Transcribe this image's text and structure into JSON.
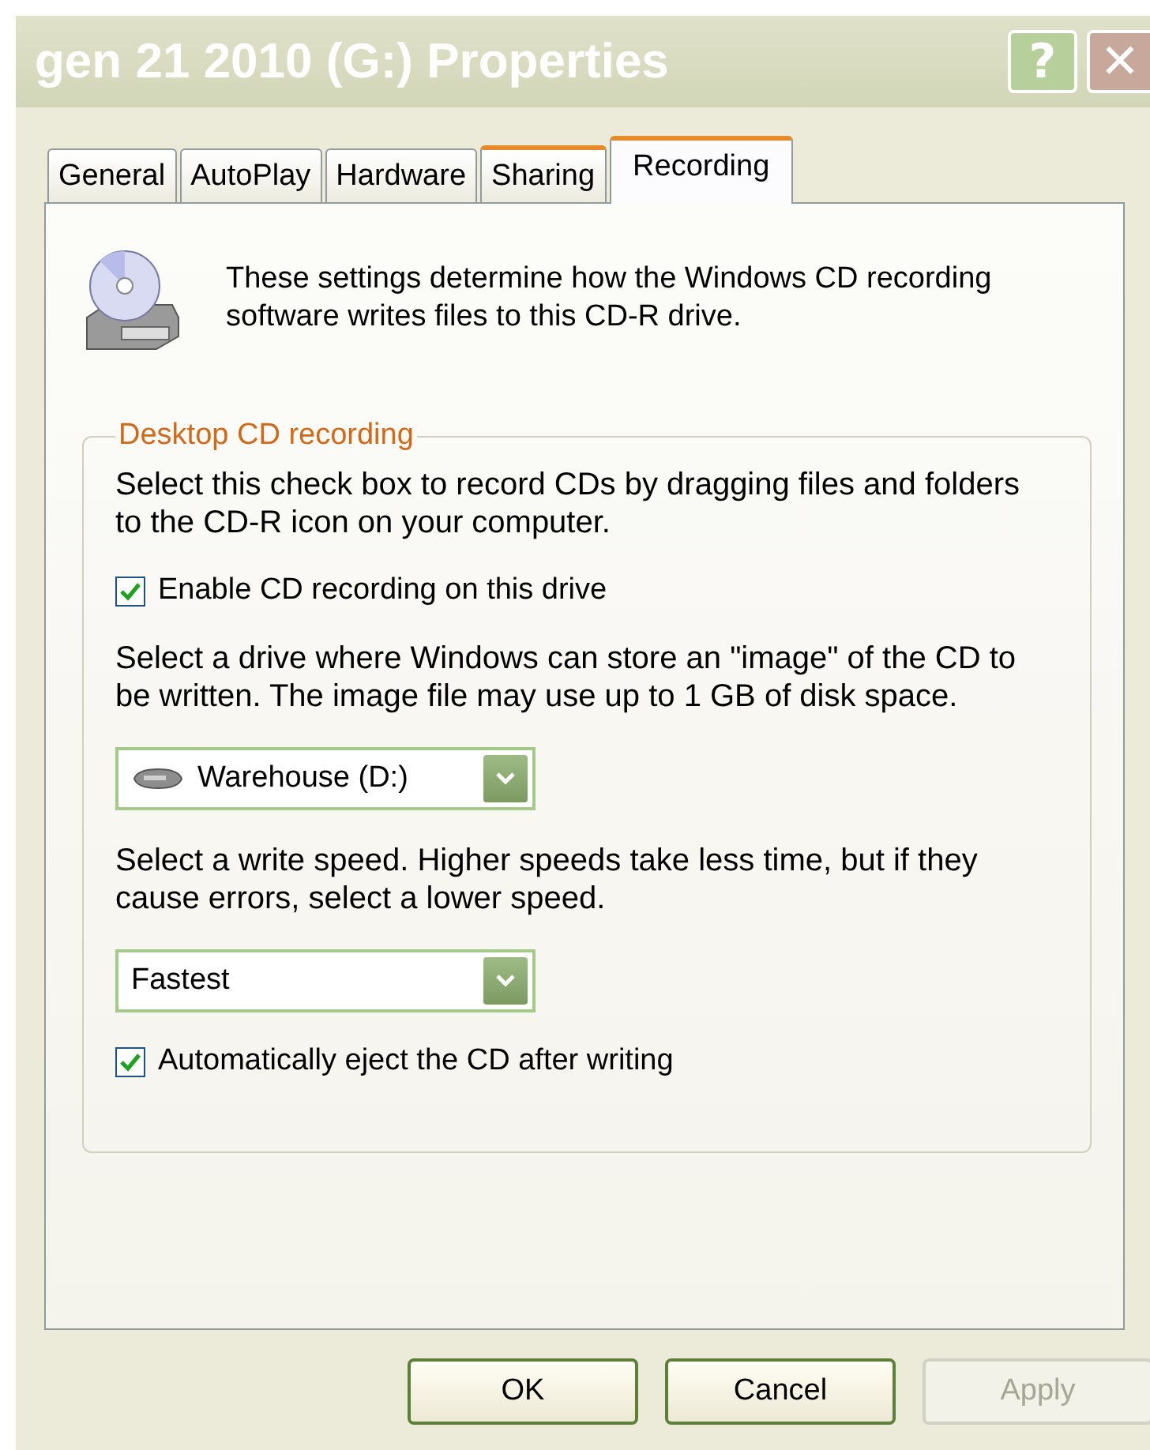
{
  "window": {
    "title": "gen 21 2010 (G:) Properties",
    "help_button": "?",
    "close_button": "✕"
  },
  "tabs": [
    {
      "label": "General",
      "selected": false
    },
    {
      "label": "AutoPlay",
      "selected": false
    },
    {
      "label": "Hardware",
      "selected": false
    },
    {
      "label": "Sharing",
      "selected": false
    },
    {
      "label": "Recording",
      "selected": true
    }
  ],
  "intro": "These settings determine how the Windows CD recording software writes files to this CD-R drive.",
  "group": {
    "title": "Desktop CD recording",
    "items": [
      {
        "kind": "text",
        "text": "Select this check box to record CDs by dragging files and folders to the CD-R icon on your computer."
      },
      {
        "kind": "checkbox",
        "label": "Enable CD recording on this drive",
        "checked": true
      },
      {
        "kind": "text",
        "text": "Select a drive where Windows can store an \"image\" of the CD to be written. The image file may use up to 1 GB of disk space."
      },
      {
        "kind": "dropdown",
        "value": "Warehouse (D:)",
        "drive_icon": true
      },
      {
        "kind": "text",
        "text": "Select a write speed.  Higher speeds take less time, but if they cause errors, select a lower speed."
      },
      {
        "kind": "dropdown",
        "value": "Fastest",
        "drive_icon": false
      },
      {
        "kind": "checkbox",
        "label": "Automatically eject the CD after writing",
        "checked": true
      }
    ]
  },
  "buttons": [
    {
      "label": "OK",
      "disabled": false
    },
    {
      "label": "Cancel",
      "disabled": false
    },
    {
      "label": "Apply",
      "disabled": true
    }
  ]
}
